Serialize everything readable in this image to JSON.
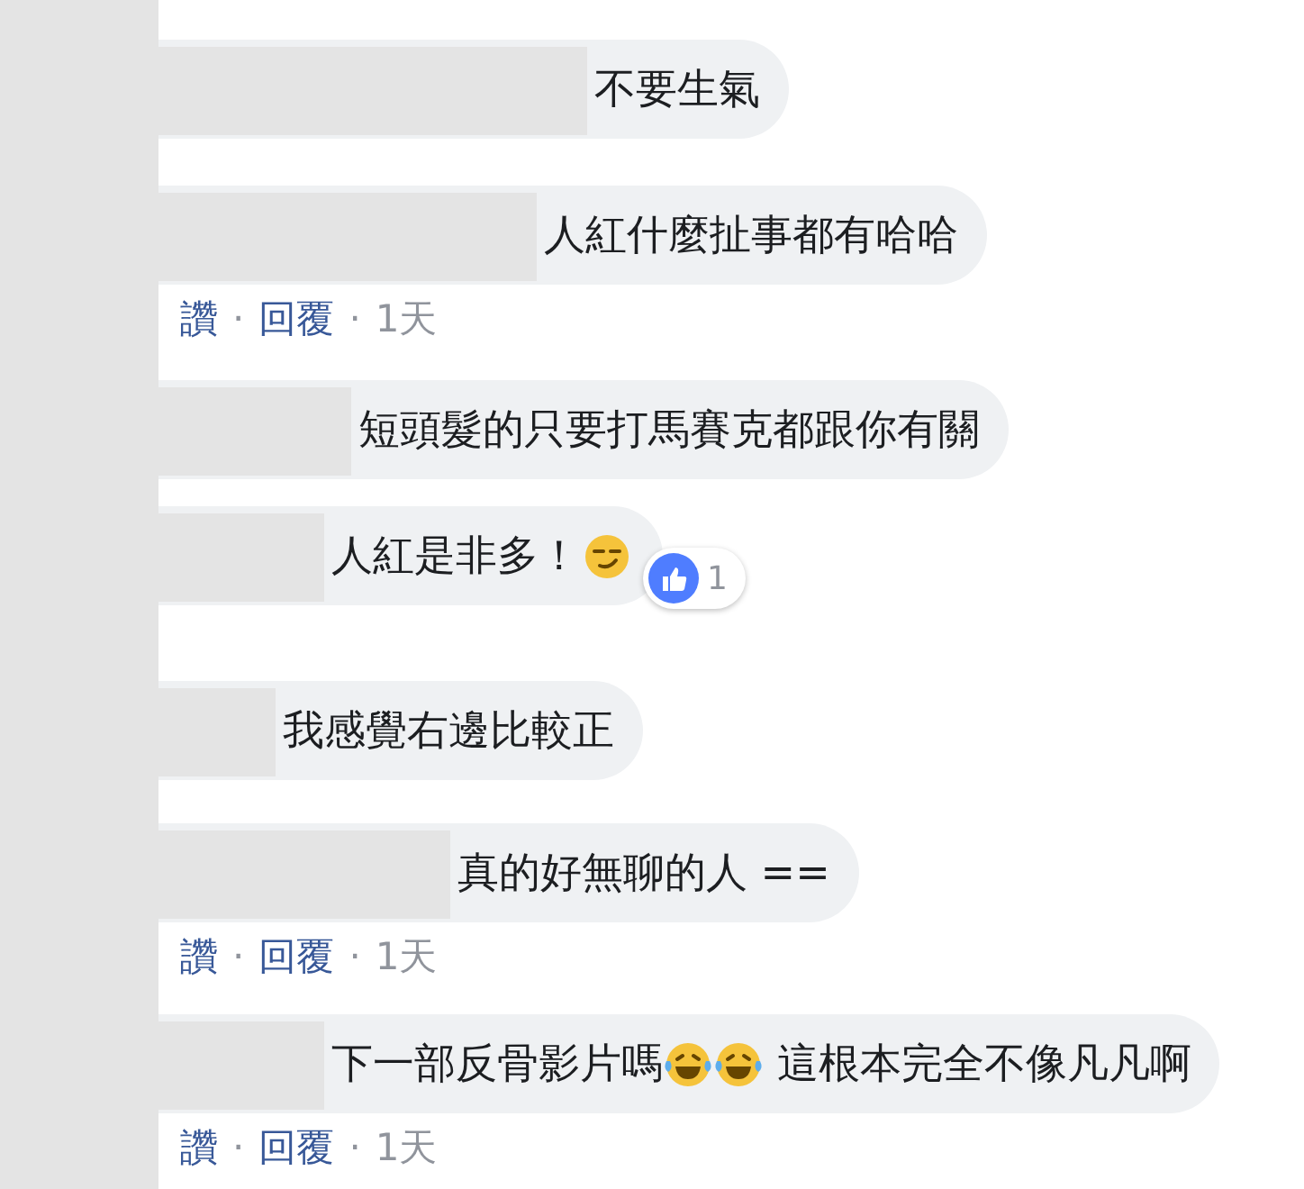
{
  "comments": [
    {
      "name_hidden": true,
      "parts": [
        {
          "kind": "text",
          "text": "不要生氣"
        }
      ]
    },
    {
      "name_hidden": true,
      "parts": [
        {
          "kind": "text",
          "text": "人紅什麼扯事都有哈哈"
        }
      ],
      "actions": [
        {
          "kind": "link",
          "text": "讚"
        },
        {
          "kind": "dot",
          "text": "·"
        },
        {
          "kind": "link",
          "text": "回覆"
        },
        {
          "kind": "dot",
          "text": "·"
        },
        {
          "kind": "time",
          "text": "1天"
        }
      ]
    },
    {
      "name_hidden": true,
      "parts": [
        {
          "kind": "text",
          "text": "短頭髮的只要打馬賽克都跟你有關"
        }
      ]
    },
    {
      "name_hidden": true,
      "parts": [
        {
          "kind": "text",
          "text": "人紅是非多！"
        },
        {
          "kind": "smirk_emoji"
        }
      ],
      "reaction": {
        "count": "1"
      }
    },
    {
      "name_hidden": true,
      "parts": [
        {
          "kind": "text",
          "text": "我感覺右邊比較正"
        }
      ]
    },
    {
      "name_hidden": true,
      "parts": [
        {
          "kind": "text",
          "text": "真的好無聊的人 =="
        }
      ],
      "actions": [
        {
          "kind": "link",
          "text": "讚"
        },
        {
          "kind": "dot",
          "text": "·"
        },
        {
          "kind": "link",
          "text": "回覆"
        },
        {
          "kind": "dot",
          "text": "·"
        },
        {
          "kind": "time",
          "text": "1天"
        }
      ]
    },
    {
      "name_hidden": true,
      "parts": [
        {
          "kind": "text",
          "text": "下一部反骨影片嗎"
        },
        {
          "kind": "laugh_emoji"
        },
        {
          "kind": "laugh_emoji"
        },
        {
          "kind": "text",
          "text": " 這根本完全不像凡凡啊"
        }
      ],
      "actions": [
        {
          "kind": "link",
          "text": "讚"
        },
        {
          "kind": "dot",
          "text": "·"
        },
        {
          "kind": "link",
          "text": "回覆"
        },
        {
          "kind": "dot",
          "text": "·"
        },
        {
          "kind": "time",
          "text": "1天"
        }
      ]
    }
  ]
}
